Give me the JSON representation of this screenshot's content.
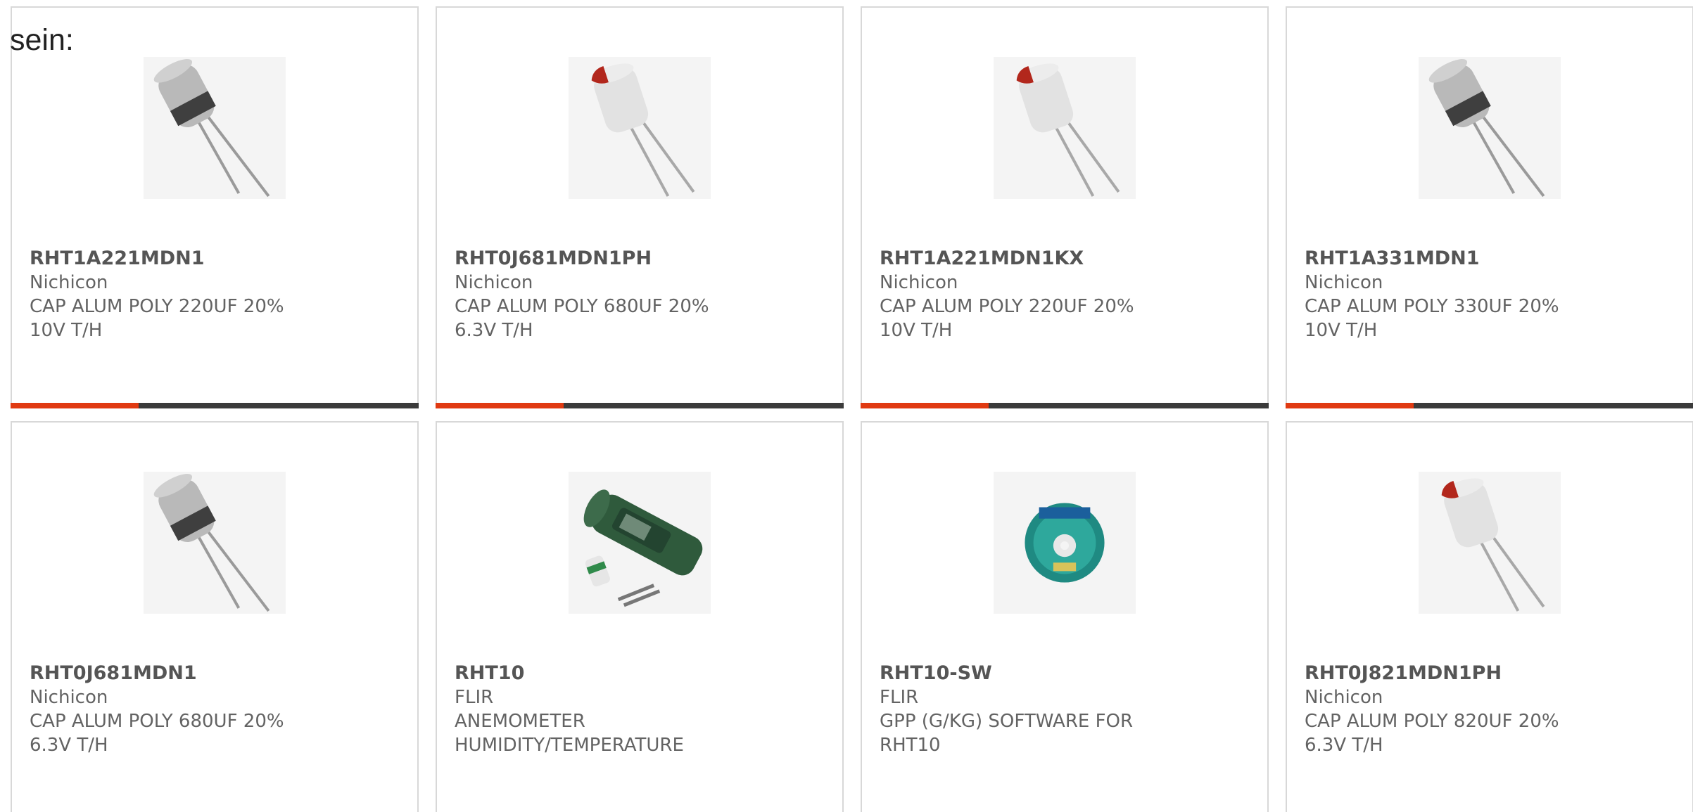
{
  "intro_text": "sein:",
  "colors": {
    "accent": "#e03a12",
    "bar": "#3b3b3b",
    "border": "#d8d8d8"
  },
  "products": [
    {
      "part": "RHT1A221MDN1",
      "manufacturer": "Nichicon",
      "description": "CAP ALUM POLY 220UF 20% 10V T/H",
      "icon": "capacitor-gray-icon"
    },
    {
      "part": "RHT0J681MDN1PH",
      "manufacturer": "Nichicon",
      "description": "CAP ALUM POLY 680UF 20% 6.3V T/H",
      "icon": "capacitor-red-icon"
    },
    {
      "part": "RHT1A221MDN1KX",
      "manufacturer": "Nichicon",
      "description": "CAP ALUM POLY 220UF 20% 10V T/H",
      "icon": "capacitor-red-icon"
    },
    {
      "part": "RHT1A331MDN1",
      "manufacturer": "Nichicon",
      "description": "CAP ALUM POLY 330UF 20% 10V T/H",
      "icon": "capacitor-gray-icon"
    },
    {
      "part": "RHT0J681MDN1",
      "manufacturer": "Nichicon",
      "description": "CAP ALUM POLY 680UF 20% 6.3V T/H",
      "icon": "capacitor-gray-icon"
    },
    {
      "part": "RHT10",
      "manufacturer": "FLIR",
      "description": "ANEMOMETER HUMIDITY/TEMPERATURE",
      "icon": "anemometer-device-icon"
    },
    {
      "part": "RHT10-SW",
      "manufacturer": "FLIR",
      "description": "GPP (G/KG) SOFTWARE FOR RHT10",
      "icon": "software-cd-icon"
    },
    {
      "part": "RHT0J821MDN1PH",
      "manufacturer": "Nichicon",
      "description": "CAP ALUM POLY 820UF 20% 6.3V T/H",
      "icon": "capacitor-red-icon"
    }
  ]
}
